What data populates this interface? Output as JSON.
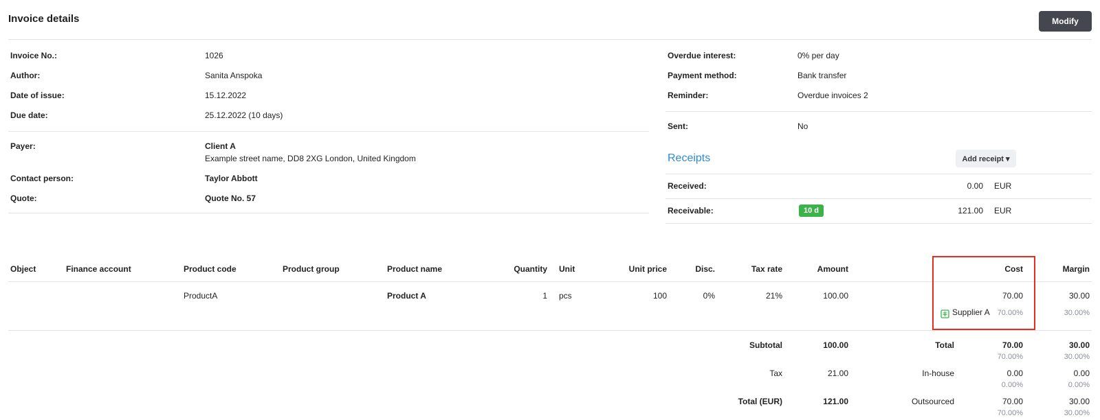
{
  "header": {
    "title": "Invoice details",
    "modify_label": "Modify"
  },
  "details_left": [
    {
      "label": "Invoice No.:",
      "value": "1026"
    },
    {
      "label": "Author:",
      "value": "Sanita Anspoka"
    },
    {
      "label": "Date of issue:",
      "value": "15.12.2022"
    },
    {
      "label": "Due date:",
      "value": "25.12.2022 (10 days)"
    }
  ],
  "payer": {
    "label": "Payer:",
    "name": "Client A",
    "address": "Example street name, DD8 2XG London, United Kingdom",
    "contact_label": "Contact person:",
    "contact": "Taylor Abbott",
    "quote_label": "Quote:",
    "quote": "Quote No. 57"
  },
  "details_right": [
    {
      "label": "Overdue interest:",
      "value": "0% per day"
    },
    {
      "label": "Payment method:",
      "value": "Bank transfer"
    },
    {
      "label": "Reminder:",
      "value": "Overdue invoices 2"
    }
  ],
  "sent": {
    "label": "Sent:",
    "value": "No"
  },
  "receipts": {
    "title": "Receipts",
    "add_label": "Add receipt ▾",
    "received_label": "Received:",
    "received_amount": "0.00",
    "received_currency": "EUR",
    "receivable_label": "Receivable:",
    "receivable_badge": "10 d",
    "receivable_amount": "121.00",
    "receivable_currency": "EUR",
    "badge_color": "#3bb24a"
  },
  "table": {
    "headers": {
      "object": "Object",
      "finance_account": "Finance account",
      "product_code": "Product code",
      "product_group": "Product group",
      "product_name": "Product name",
      "quantity": "Quantity",
      "unit": "Unit",
      "unit_price": "Unit price",
      "disc": "Disc.",
      "tax_rate": "Tax rate",
      "amount": "Amount",
      "cost": "Cost",
      "margin": "Margin"
    },
    "row": {
      "product_code": "ProductA",
      "product_name": "Product A",
      "quantity": "1",
      "unit": "pcs",
      "unit_price": "100",
      "disc": "0%",
      "tax_rate": "21%",
      "amount": "100.00",
      "cost": "70.00",
      "margin": "30.00",
      "supplier": "Supplier A",
      "supplier_pct": "70.00%",
      "margin_pct": "30.00%"
    }
  },
  "totals": {
    "subtotal_label": "Subtotal",
    "subtotal": "100.00",
    "tax_label": "Tax",
    "tax": "21.00",
    "total_label": "Total (EUR)",
    "total": "121.00",
    "cost_rows": [
      {
        "label": "Total",
        "cost": "70.00",
        "cost_pct": "70.00%",
        "margin": "30.00",
        "margin_pct": "30.00%"
      },
      {
        "label": "In-house",
        "cost": "0.00",
        "cost_pct": "0.00%",
        "margin": "0.00",
        "margin_pct": "0.00%"
      },
      {
        "label": "Outsourced",
        "cost": "70.00",
        "cost_pct": "70.00%",
        "margin": "30.00",
        "margin_pct": "30.00%"
      }
    ]
  },
  "colors": {
    "highlight": "#ee2a1e",
    "link": "#2e8ad8",
    "button": "#44474f"
  },
  "icons": {
    "supplier": "supplier-doc-icon"
  }
}
